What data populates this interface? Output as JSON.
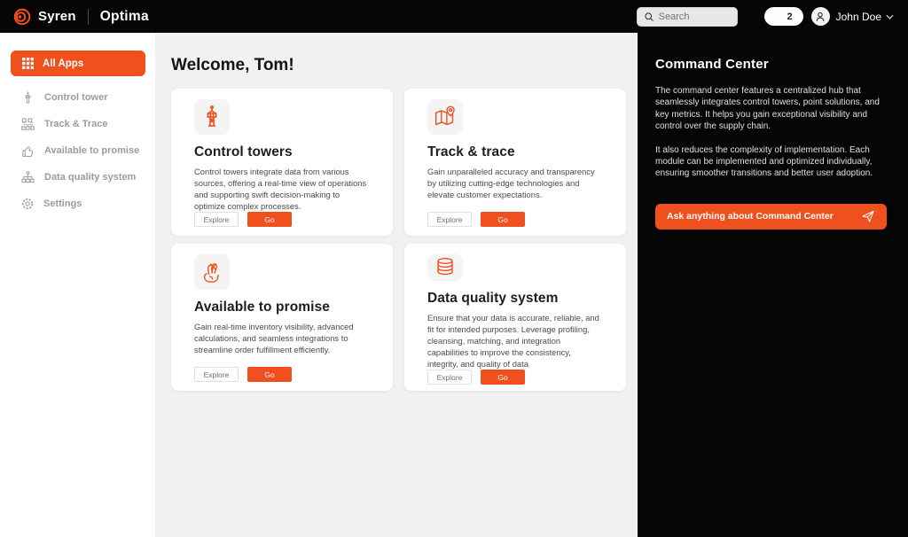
{
  "colors": {
    "accent": "#F0501E",
    "topbar_bg": "#060606",
    "panel_bg": "#050505",
    "main_bg": "#F1F1F3"
  },
  "topbar": {
    "brand": "Syren",
    "product": "Optima",
    "search_placeholder": "Search",
    "notification_count": "2",
    "user_name": "John Doe"
  },
  "sidebar": {
    "items": [
      {
        "label": "All Apps",
        "icon": "grid-icon",
        "active": true
      },
      {
        "label": "Control tower",
        "icon": "control-tower-icon",
        "active": false
      },
      {
        "label": "Track & Trace",
        "icon": "nodes-icon",
        "active": false
      },
      {
        "label": "Available to promise",
        "icon": "thumbs-up-icon",
        "active": false
      },
      {
        "label": "Data quality system",
        "icon": "hierarchy-icon",
        "active": false
      },
      {
        "label": "Settings",
        "icon": "gear-icon",
        "active": false
      }
    ]
  },
  "main": {
    "welcome": "Welcome, Tom!",
    "cards": [
      {
        "title": "Control towers",
        "icon": "control-tower-icon",
        "description": "Control towers integrate data from various sources, offering a real-time view of operations and supporting swift decision-making to optimize complex processes.",
        "explore_label": "Explore",
        "go_label": "Go"
      },
      {
        "title": "Track & trace",
        "icon": "map-pin-icon",
        "description": "Gain unparalleled accuracy and transparency by utilizing cutting-edge technologies and elevate customer expectations.",
        "explore_label": "Explore",
        "go_label": "Go"
      },
      {
        "title": "Available to promise",
        "icon": "crossed-fingers-icon",
        "description": "Gain real-time inventory visibility, advanced calculations, and seamless integrations to streamline order fulfillment efficiently.",
        "explore_label": "Explore",
        "go_label": "Go"
      },
      {
        "title": "Data quality system",
        "icon": "database-icon",
        "description": "Ensure that your data is accurate, reliable, and fit for intended purposes. Leverage profiling, cleansing, matching, and integration capabilities to improve the consistency, integrity, and quality of data",
        "explore_label": "Explore",
        "go_label": "Go"
      }
    ]
  },
  "panel": {
    "title": "Command Center",
    "paragraph1": "The command center features a centralized hub that seamlessly integrates control towers, point solutions, and key metrics. It helps you gain exceptional visibility and control over the supply chain.",
    "paragraph2": "It also reduces the complexity of implementation. Each module can be implemented and optimized individually, ensuring smoother transitions and better user adoption.",
    "cta_label": "Ask anything about Command Center",
    "cta_icon": "send-icon"
  }
}
